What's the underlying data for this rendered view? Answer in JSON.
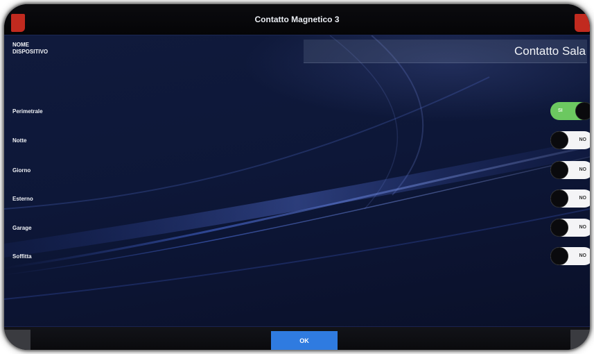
{
  "dialog": {
    "title": "Contatto Magnetico 3"
  },
  "device_name": {
    "label_line1": "NOME",
    "label_line2": "DISPOSITIVO",
    "value": "Contatto Sala"
  },
  "zones": [
    {
      "label": "Perimetrale",
      "state": "SI",
      "on": true
    },
    {
      "label": "Notte",
      "state": "NO",
      "on": false
    },
    {
      "label": "Giorno",
      "state": "NO",
      "on": false
    },
    {
      "label": "Esterno",
      "state": "NO",
      "on": false
    },
    {
      "label": "Garage",
      "state": "NO",
      "on": false
    },
    {
      "label": "Soffitta",
      "state": "NO",
      "on": false
    }
  ],
  "footer": {
    "ok_label": "OK"
  },
  "colors": {
    "toggle_on": "#6cc860",
    "toggle_off": "#f4f4f6",
    "ok_button": "#2f7be0",
    "corner_buttons": "#c12a1f",
    "background": "#0d1738"
  }
}
